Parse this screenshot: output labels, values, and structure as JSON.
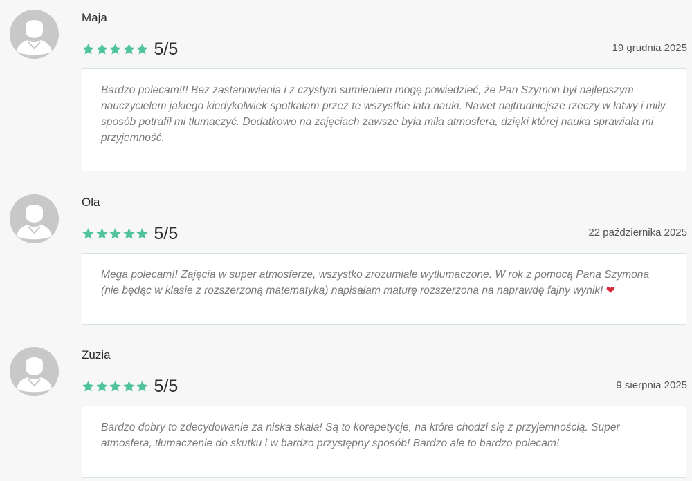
{
  "reviews": [
    {
      "author": "Maja",
      "score": "5/5",
      "stars": 5,
      "date": "19 grudnia 2025",
      "text": "Bardzo polecam!!! Bez zastanowienia i z czystym sumieniem mogę powiedzieć, że Pan Szymon był najlepszym nauczycielem jakiego kiedykolwiek spotkałam przez te wszystkie lata nauki. Nawet najtrudniejsze rzeczy w łatwy i miły sposób potrafił mi tłumaczyć. Dodatkowo na zajęciach zawsze była miła atmosfera, dzięki której nauka sprawiała mi przyjemność.",
      "emoji": ""
    },
    {
      "author": "Ola",
      "score": "5/5",
      "stars": 5,
      "date": "22 października 2025",
      "text": "Mega polecam!! Zajęcia w super atmosferze, wszystko zrozumiale wytłumaczone. W rok z pomocą Pana Szymona (nie będąc w klasie z rozszerzoną matematyka) napisałam maturę rozszerzona na naprawdę fajny wynik! ",
      "emoji": "❤"
    },
    {
      "author": "Zuzia",
      "score": "5/5",
      "stars": 5,
      "date": "9 sierpnia 2025",
      "text": "Bardzo dobry to zdecydowanie za niska skala! Są to korepetycje, na które chodzi się z przyjemnością. Super atmosfera, tłumaczenie do skutku i w bardzo przystępny sposób! Bardzo ale to bardzo polecam!",
      "emoji": ""
    }
  ],
  "icons": {
    "avatar": "user-avatar-icon",
    "star": "star-icon",
    "heart": "heart-icon"
  },
  "colors": {
    "star": "#4fc39a",
    "avatar_bg": "#c8c8c8",
    "card_border": "#d7e3ea",
    "review_text": "#7a7a7a",
    "heart": "#d62b3b"
  }
}
